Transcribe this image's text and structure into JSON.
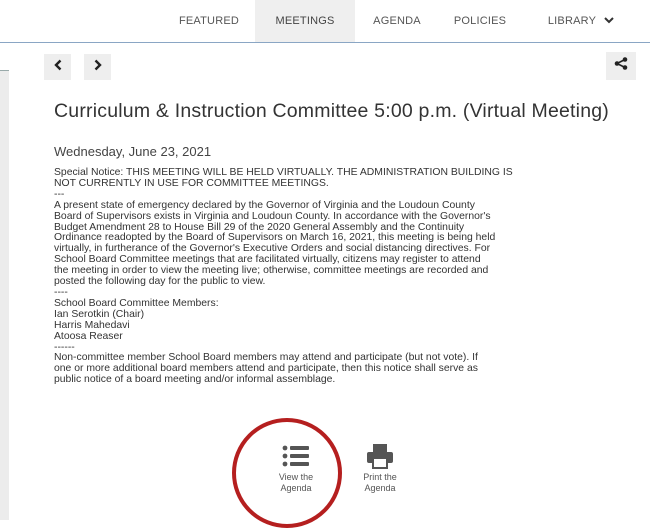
{
  "nav": {
    "tabs": [
      {
        "label": "FEATURED"
      },
      {
        "label": "MEETINGS"
      },
      {
        "label": "AGENDA"
      },
      {
        "label": "POLICIES"
      },
      {
        "label": "LIBRARY"
      }
    ],
    "active_tab": "MEETINGS"
  },
  "icons": {
    "prev": "chevron-left-icon",
    "next": "chevron-right-icon",
    "share": "share-icon",
    "view_agenda": "list-icon",
    "print_agenda": "print-icon"
  },
  "meeting": {
    "title": "Curriculum & Instruction Committee 5:00 p.m. (Virtual Meeting)",
    "date": "Wednesday, June 23, 2021",
    "lines": [
      "Special Notice: THIS MEETING WILL BE HELD VIRTUALLY. THE ADMINISTRATION BUILDING IS",
      "NOT CURRENTLY IN USE FOR COMMITTEE MEETINGS.",
      "---",
      "A present state of emergency declared by the Governor of Virginia and the Loudoun County",
      "Board of Supervisors exists in Virginia and Loudoun County. In accordance with the Governor's",
      "Budget Amendment 28 to House Bill 29 of the 2020 General Assembly and the Continuity",
      "Ordinance readopted by the Board of Supervisors on March 16, 2021, this meeting is being held",
      "virtually, in furtherance of the Governor's Executive Orders and social distancing directives. For",
      "School Board Committee meetings that are facilitated virtually, citizens may register to attend",
      "the meeting in order to view the meeting live; otherwise, committee meetings are recorded and",
      "posted the following day for the public to view.",
      "----",
      "School Board Committee Members:",
      "Ian Serotkin (Chair)",
      "Harris Mahedavi",
      "Atoosa Reaser",
      "------",
      "Non-committee member School Board members may attend and participate (but not vote). If",
      "one or more additional board members attend and participate, then this notice shall serve as",
      "public notice of a board meeting and/or informal assemblage."
    ]
  },
  "actions": {
    "view_line1": "View the",
    "view_line2": "Agenda",
    "print_line1": "Print the",
    "print_line2": "Agenda"
  },
  "colors": {
    "highlight_circle": "#b51f1f",
    "nav_border": "#8aa6c4"
  }
}
